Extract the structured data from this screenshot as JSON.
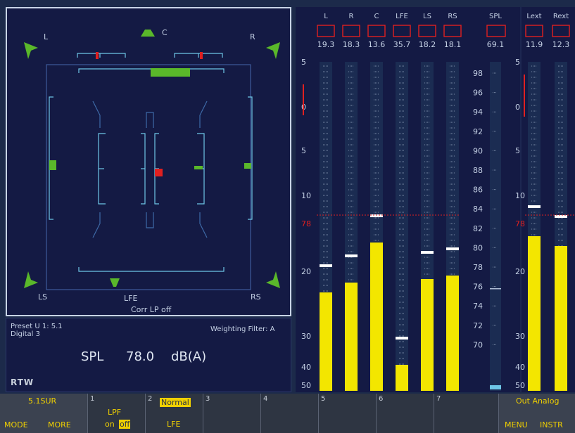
{
  "surround": {
    "labels": {
      "L": "L",
      "C": "C",
      "R": "R",
      "LS": "LS",
      "LFE": "LFE",
      "RS": "RS"
    },
    "corr_label": "Corr LP off"
  },
  "info": {
    "preset": "Preset U 1: 5.1",
    "input": "Digital 3",
    "weighting": "Weighting Filter: A",
    "spl_label": "SPL",
    "spl_value": "78.0",
    "spl_unit": "dB(A)",
    "logo": "RTW"
  },
  "meters": {
    "channels": [
      {
        "name": "L",
        "peak": "19.3",
        "level": 0.3
      },
      {
        "name": "R",
        "peak": "18.3",
        "level": 0.33
      },
      {
        "name": "C",
        "peak": "13.6",
        "level": 0.45
      },
      {
        "name": "LFE",
        "peak": "35.7",
        "level": 0.08
      },
      {
        "name": "LS",
        "peak": "18.2",
        "level": 0.34
      },
      {
        "name": "RS",
        "peak": "18.1",
        "level": 0.35
      }
    ],
    "spl": {
      "name": "SPL",
      "peak": "69.1"
    },
    "ext": [
      {
        "name": "Lext",
        "peak": "11.9",
        "level": 0.47
      },
      {
        "name": "Rext",
        "peak": "12.3",
        "level": 0.44
      }
    ],
    "left_scale": [
      "5",
      "0",
      "5",
      "10",
      "20",
      "30",
      "40",
      "50"
    ],
    "ref_label": "78",
    "spl_scale": [
      "98",
      "96",
      "94",
      "92",
      "90",
      "88",
      "86",
      "84",
      "82",
      "80",
      "78",
      "76",
      "74",
      "72",
      "70"
    ],
    "right_scale": [
      "5",
      "0",
      "5",
      "10",
      "78",
      "20",
      "30",
      "40",
      "50"
    ]
  },
  "bottombar": {
    "mode_title": "5.1SUR",
    "mode_key": "MODE",
    "more_key": "MORE",
    "cells": [
      {
        "num": "1",
        "line1": "LPF",
        "line2_a": "on",
        "line2_b": "off"
      },
      {
        "num": "2",
        "line1": "Normal",
        "line2": "LFE"
      },
      {
        "num": "3"
      },
      {
        "num": "4"
      },
      {
        "num": "5"
      },
      {
        "num": "6"
      },
      {
        "num": "7"
      }
    ],
    "out_label": "Out Analog",
    "menu_key": "MENU",
    "instr_key": "INSTR"
  },
  "colors": {
    "panel_bg": "#141a44",
    "meter_yellow": "#f3e600",
    "marker_green": "#5ab82a",
    "overload_red": "#e02020",
    "scale_cyan": "#6ec6e6"
  }
}
